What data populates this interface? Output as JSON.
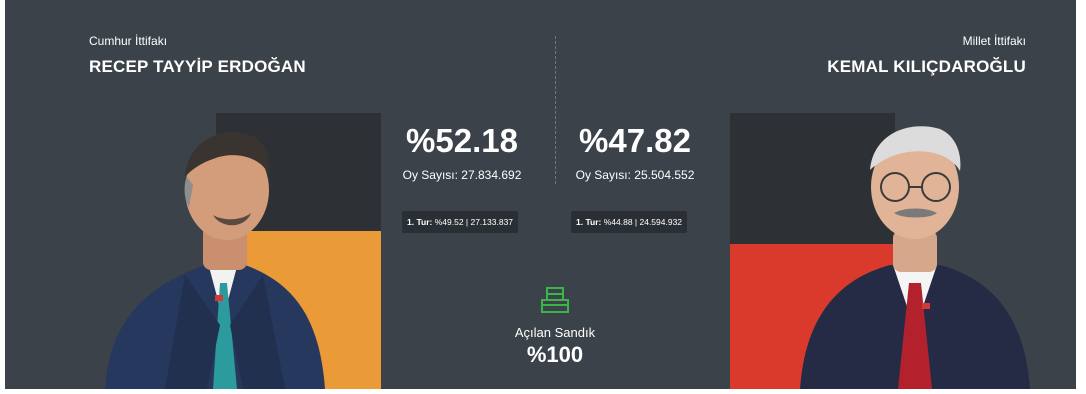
{
  "colors": {
    "panel_bg": "#3b4249",
    "left_bar": "#ea9a36",
    "right_bar": "#d93a2b",
    "dark_block": "#2d3136",
    "ballot_icon": "#39b54a"
  },
  "left": {
    "alliance": "Cumhur İttifakı",
    "name": "RECEP TAYYİP ERDOĞAN",
    "percent": "%52.18",
    "share": 52.18,
    "votes": "Oy Sayısı: 27.834.692",
    "round1_prefix": "1. Tur:",
    "round1_value": "%49.52 | 27.133.837"
  },
  "right": {
    "alliance": "Millet İttifakı",
    "name": "KEMAL KILIÇDAROĞLU",
    "percent": "%47.82",
    "share": 47.82,
    "votes": "Oy Sayısı: 25.504.552",
    "round1_prefix": "1. Tur:",
    "round1_value": "%44.88 | 24.594.932"
  },
  "ballot": {
    "icon": "ballot-box-icon",
    "label": "Açılan Sandık",
    "percent": "%100"
  }
}
